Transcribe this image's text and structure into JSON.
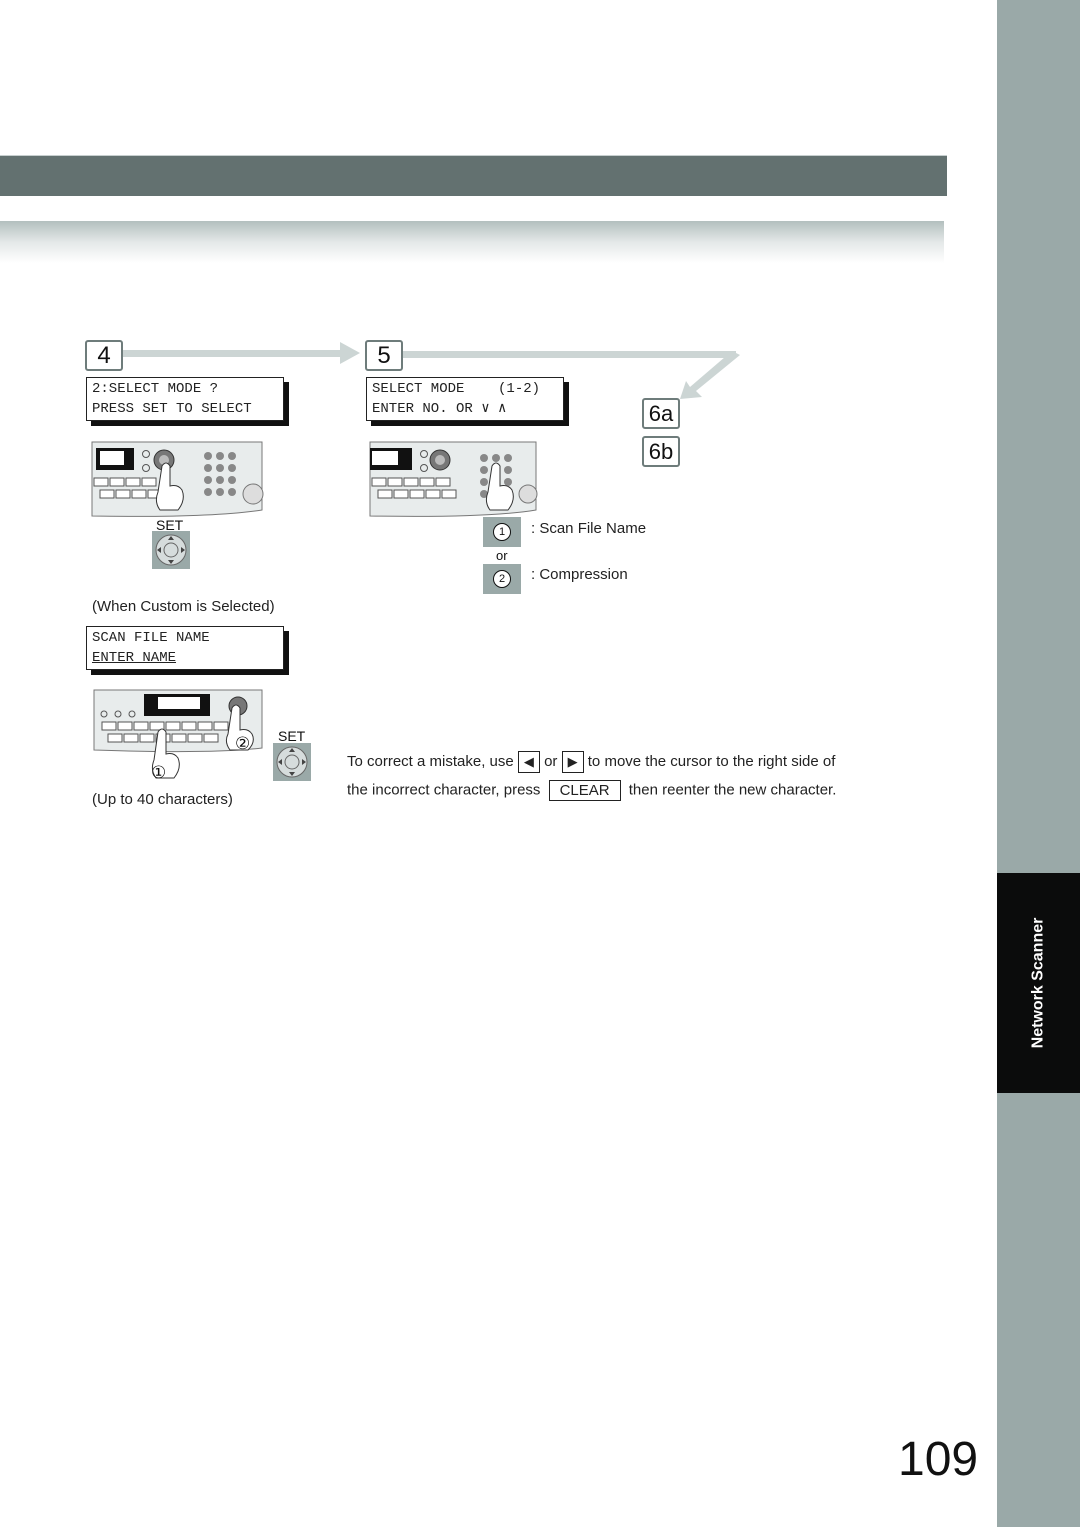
{
  "side_tab": {
    "label": "Network Scanner"
  },
  "steps": {
    "step4": {
      "number": "4",
      "lcd_lines": [
        "2:SELECT MODE ?",
        "PRESS SET TO SELECT"
      ],
      "set_label": "SET",
      "note": "(When Custom is Selected)",
      "lcd2_lines": [
        "SCAN FILE NAME",
        "ENTER NAME"
      ],
      "set_label2": "SET",
      "limit_note": "(Up to 40 characters)",
      "callout1": "①",
      "callout2": "②"
    },
    "step5": {
      "number": "5",
      "lcd_lines": [
        "SELECT MODE    (1-2)",
        "ENTER NO. OR ∨ ∧"
      ],
      "options": [
        {
          "key": "1",
          "label": ": Scan File Name"
        },
        {
          "key": "2",
          "label": ": Compression"
        }
      ],
      "or_label": "or"
    },
    "step6": {
      "a": "6a",
      "b": "6b"
    }
  },
  "instruction": {
    "part1": "To correct a mistake, use",
    "left_key": "◀",
    "or": "or",
    "right_key": "▶",
    "part2": "to move the cursor to the right side of",
    "part3": "the incorrect character, press",
    "clear_key": "CLEAR",
    "part4": "then reenter the new character."
  },
  "page_number": "109",
  "colors": {
    "header": "#637170",
    "side": "#9aa9a8",
    "tab": "#0b0c0c",
    "arrow": "#ccd5d4"
  }
}
